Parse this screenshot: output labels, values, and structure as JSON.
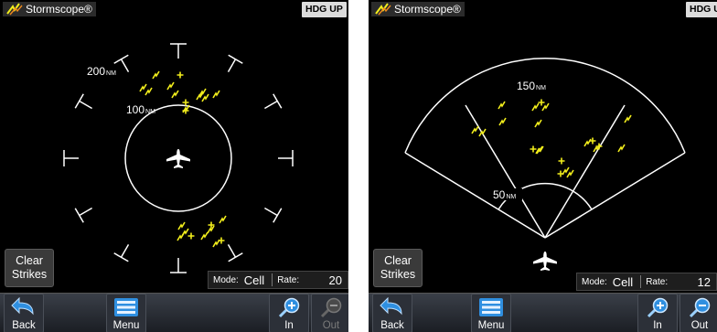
{
  "left_screen": {
    "title": "Stormscope®",
    "orientation_button": "HDG UP",
    "range_outer": "200",
    "range_inner": "100",
    "range_unit": "NM",
    "clear_strikes": [
      "Clear",
      "Strikes"
    ],
    "mode_label": "Mode:",
    "mode_value": "Cell",
    "rate_label": "Rate:",
    "rate_value": "20",
    "softkeys": {
      "back": "Back",
      "menu": "Menu",
      "zoom_in": "In",
      "zoom_out": "Out"
    }
  },
  "right_screen": {
    "title": "Stormscope®",
    "orientation_button": "HDG UP",
    "range_outer": "150",
    "range_inner": "50",
    "range_unit": "NM",
    "clear_strikes": [
      "Clear",
      "Strikes"
    ],
    "mode_label": "Mode:",
    "mode_value": "Cell",
    "rate_label": "Rate:",
    "rate_value": "12",
    "softkeys": {
      "back": "Back",
      "menu": "Menu",
      "zoom_in": "In",
      "zoom_out": "Out"
    }
  },
  "colors": {
    "strike": "#f2ee1c",
    "background": "#000000",
    "range_ring": "#ffffff",
    "softkey_accent": "#2f8fe0"
  },
  "icons": {
    "title": "lightning-icon",
    "strike": "lightning-bolt",
    "cell": "plus-mark",
    "ownship": "airplane-icon",
    "back": "back-arrow-icon",
    "menu": "menu-list-icon",
    "zoom_in": "zoom-in-icon",
    "zoom_out": "zoom-out-icon"
  }
}
